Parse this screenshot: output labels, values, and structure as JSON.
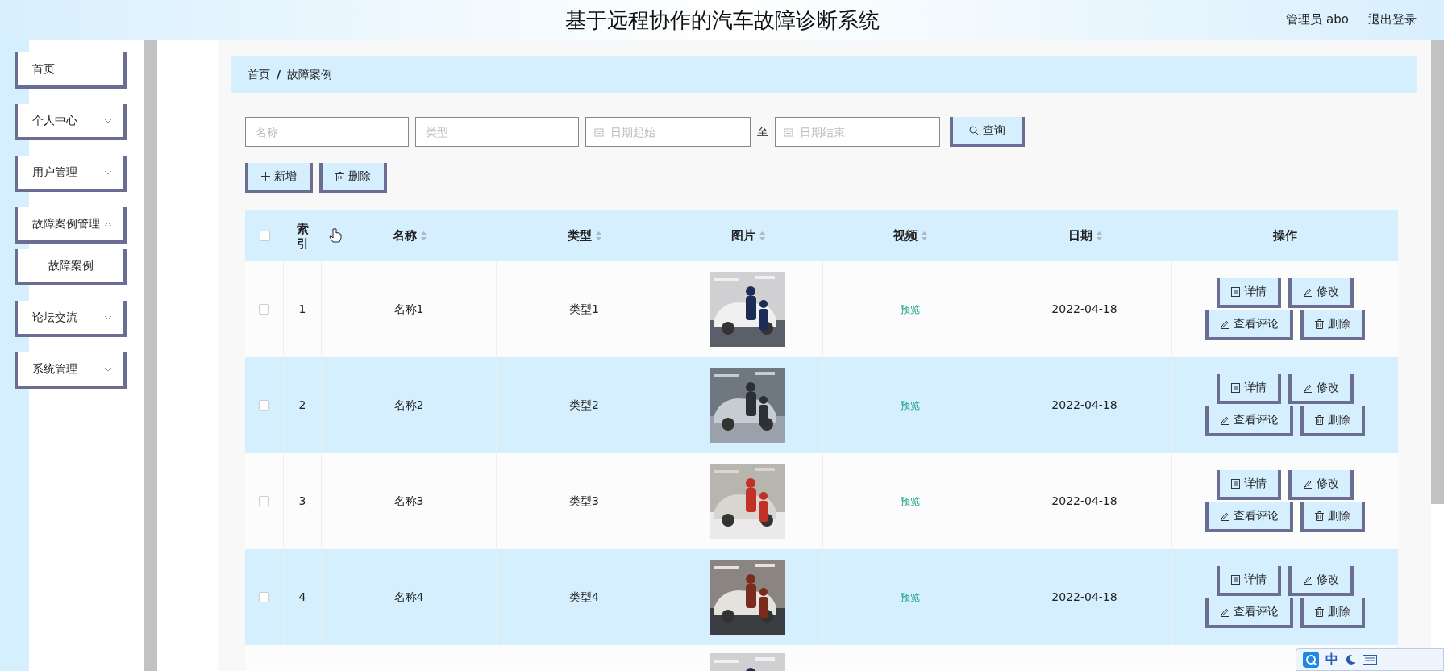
{
  "header": {
    "title": "基于远程协作的汽车故障诊断系统",
    "user": "管理员 abo",
    "logout": "退出登录"
  },
  "sidebar": {
    "items": [
      {
        "label": "首页",
        "expandable": false
      },
      {
        "label": "个人中心",
        "expandable": true,
        "expanded": false
      },
      {
        "label": "用户管理",
        "expandable": true,
        "expanded": false
      },
      {
        "label": "故障案例管理",
        "expandable": true,
        "expanded": true,
        "children": [
          {
            "label": "故障案例"
          }
        ]
      },
      {
        "label": "论坛交流",
        "expandable": true,
        "expanded": false
      },
      {
        "label": "系统管理",
        "expandable": true,
        "expanded": false
      }
    ]
  },
  "breadcrumb": {
    "items": [
      "首页",
      "故障案例"
    ],
    "separator": "/"
  },
  "filters": {
    "fields": [
      {
        "kind": "text",
        "placeholder": "名称"
      },
      {
        "kind": "text",
        "placeholder": "类型"
      },
      {
        "kind": "date",
        "placeholder": "日期起始"
      },
      {
        "kind": "label",
        "text": "至"
      },
      {
        "kind": "date",
        "placeholder": "日期结束"
      }
    ],
    "search_button": "查询"
  },
  "toolbar": [
    {
      "kind": "add",
      "label": "新增"
    },
    {
      "kind": "delete",
      "label": "删除"
    }
  ],
  "table": {
    "select_all_checked": false,
    "columns": [
      {
        "label": "索引",
        "sortable": false
      },
      {
        "label": "名称",
        "sortable": true
      },
      {
        "label": "类型",
        "sortable": true
      },
      {
        "label": "图片",
        "sortable": true
      },
      {
        "label": "视频",
        "sortable": true
      },
      {
        "label": "日期",
        "sortable": true
      },
      {
        "label": "操作",
        "sortable": false
      }
    ],
    "rows": [
      {
        "checked": false,
        "index": "1",
        "name": "名称1",
        "type": "类型1",
        "picture": {
          "kind": "picture"
        },
        "video": "预览",
        "date": "2022-04-18",
        "actions": [
          {
            "kind": "detail",
            "label": "详情"
          },
          {
            "kind": "edit",
            "label": "修改"
          },
          {
            "kind": "comment",
            "label": "查看评论"
          },
          {
            "kind": "delete",
            "label": "删除"
          }
        ]
      },
      {
        "checked": false,
        "index": "2",
        "name": "名称2",
        "type": "类型2",
        "picture": {
          "kind": "picture"
        },
        "video": "预览",
        "date": "2022-04-18",
        "actions": [
          {
            "kind": "detail",
            "label": "详情"
          },
          {
            "kind": "edit",
            "label": "修改"
          },
          {
            "kind": "comment",
            "label": "查看评论"
          },
          {
            "kind": "delete",
            "label": "删除"
          }
        ]
      },
      {
        "checked": false,
        "index": "3",
        "name": "名称3",
        "type": "类型3",
        "picture": {
          "kind": "picture"
        },
        "video": "预览",
        "date": "2022-04-18",
        "actions": [
          {
            "kind": "detail",
            "label": "详情"
          },
          {
            "kind": "edit",
            "label": "修改"
          },
          {
            "kind": "comment",
            "label": "查看评论"
          },
          {
            "kind": "delete",
            "label": "删除"
          }
        ]
      },
      {
        "checked": false,
        "index": "4",
        "name": "名称4",
        "type": "类型4",
        "picture": {
          "kind": "picture"
        },
        "video": "预览",
        "date": "2022-04-18",
        "actions": [
          {
            "kind": "detail",
            "label": "详情"
          },
          {
            "kind": "edit",
            "label": "修改"
          },
          {
            "kind": "comment",
            "label": "查看评论"
          },
          {
            "kind": "delete",
            "label": "删除"
          }
        ]
      }
    ]
  },
  "ime": {
    "mode": "中"
  }
}
